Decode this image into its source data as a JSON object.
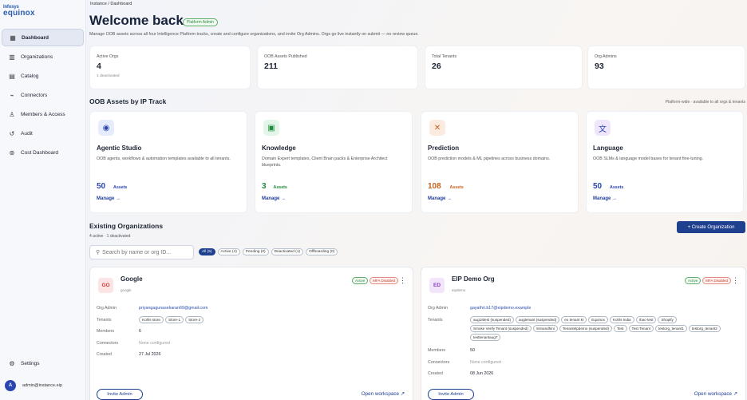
{
  "logo": {
    "line1": "Infosys",
    "line2": "equinox"
  },
  "sidebar": {
    "items": [
      {
        "label": "Dashboard",
        "icon": "dashboard-icon",
        "glyph": "▦",
        "active": true
      },
      {
        "label": "Organizations",
        "icon": "building-icon",
        "glyph": "▥"
      },
      {
        "label": "Catalog",
        "icon": "grid-icon",
        "glyph": "▤"
      },
      {
        "label": "Connectors",
        "icon": "plug-icon",
        "glyph": "⌁"
      },
      {
        "label": "Members & Access",
        "icon": "users-icon",
        "glyph": "♙"
      },
      {
        "label": "Audit",
        "icon": "history-icon",
        "glyph": "↺"
      },
      {
        "label": "Cost Dashboard",
        "icon": "dollar-icon",
        "glyph": "⊚"
      }
    ],
    "settings": {
      "label": "Settings",
      "icon": "gear-icon",
      "glyph": "⚙"
    },
    "user": {
      "initial": "A",
      "email": "admin@instance.eip"
    }
  },
  "breadcrumb": "Instance  /  Dashboard",
  "header": {
    "title": "Welcome back",
    "badge": "Platform Admin",
    "subtitle": "Manage OOB assets across all four Intelligence Platform tracks, create and configure organizations, and invite Org Admins. Orgs go live instantly on submit — no review queue."
  },
  "stats": [
    {
      "label": "Active Orgs",
      "value": "4",
      "sub": "1 deactivated"
    },
    {
      "label": "OOB Assets Published",
      "value": "211",
      "sub": ""
    },
    {
      "label": "Total Tenants",
      "value": "26",
      "sub": ""
    },
    {
      "label": "Org Admins",
      "value": "93",
      "sub": ""
    }
  ],
  "tracks_section": {
    "title": "OOB Assets by IP Track",
    "note": "Platform-wide · available to all orgs & tenants"
  },
  "tracks": [
    {
      "name": "Agentic Studio",
      "desc": "OOB agents, workflows & automation templates available to all tenants.",
      "count": "50",
      "unit": "Assets",
      "manage": "Manage  →",
      "icon": "robot-icon",
      "glyph": "◉",
      "accent": "#2a46b0",
      "icon_bg": "#e6ecfb"
    },
    {
      "name": "Knowledge",
      "desc": "Domain Expert templates, Client Brain packs & Enterprise Architect blueprints.",
      "count": "3",
      "unit": "Assets",
      "manage": "Manage  →",
      "icon": "book-icon",
      "glyph": "▣",
      "accent": "#1f8a3a",
      "icon_bg": "#e3f5e7"
    },
    {
      "name": "Prediction",
      "desc": "OOB prediction models & ML pipelines across business domains.",
      "count": "108",
      "unit": "Assets",
      "manage": "Manage  →",
      "icon": "chart-icon",
      "glyph": "✕",
      "accent": "#c9621e",
      "icon_bg": "#fbeae0"
    },
    {
      "name": "Language",
      "desc": "OOB SLMs & language model bases for tenant fine-tuning.",
      "count": "50",
      "unit": "Assets",
      "manage": "Manage  →",
      "icon": "translate-icon",
      "glyph": "文",
      "accent": "#2a46b0",
      "icon_bg": "#efe6fb"
    }
  ],
  "orgs_section": {
    "title": "Existing Organizations",
    "sub": "4 active · 1 deactivated",
    "create_label": "+  Create Organization",
    "search_placeholder": "Search by name or org ID...",
    "filters": [
      "All (5)",
      "Active (4)",
      "Pending (0)",
      "Deactivated (1)",
      "Offboarding (0)"
    ]
  },
  "orgs": [
    {
      "initials": "GO",
      "name": "Google",
      "slug": "google",
      "status": "Active",
      "mfa": "MFA Disabled",
      "admin_label": "Org Admin",
      "admin": "priyangagunasekaran69@gmail.com",
      "tenants_label": "Tenants",
      "tenants": [
        "Kohls store",
        "Store-1",
        "Store-2"
      ],
      "members_label": "Members",
      "members": "6",
      "connectors_label": "Connectors",
      "connectors": "None configured",
      "created_label": "Created",
      "created": "27 Jul 2026",
      "invite": "Invite Admin",
      "open": "Open workspace ↗"
    },
    {
      "initials": "ED",
      "name": "EIP Demo Org",
      "slug": "eipdemo",
      "status": "Active",
      "mfa": "MFA Disabled",
      "admin_label": "Org Admin",
      "admin": "gayathri.b17@eipdemo.example",
      "tenants_label": "Tenants",
      "tenants": [
        "aug18test (suspended)",
        "augtenant (suspended)",
        "eo tenant kt",
        "Equinox",
        "Kohls India",
        "rbac-test",
        "Shopify",
        "Smoke Verify Tenant (suspended)",
        "Srinandhini",
        "Tenantelpdemo (suspended)",
        "Test",
        "Test Tenant",
        "testorg_tenant1",
        "testorg_tenant2",
        "testtenantaug7"
      ],
      "members_label": "Members",
      "members": "50",
      "connectors_label": "Connectors",
      "connectors": "None configured",
      "created_label": "Created",
      "created": "08 Jun 2026",
      "invite": "Invite Admin",
      "open": "Open workspace ↗"
    }
  ]
}
